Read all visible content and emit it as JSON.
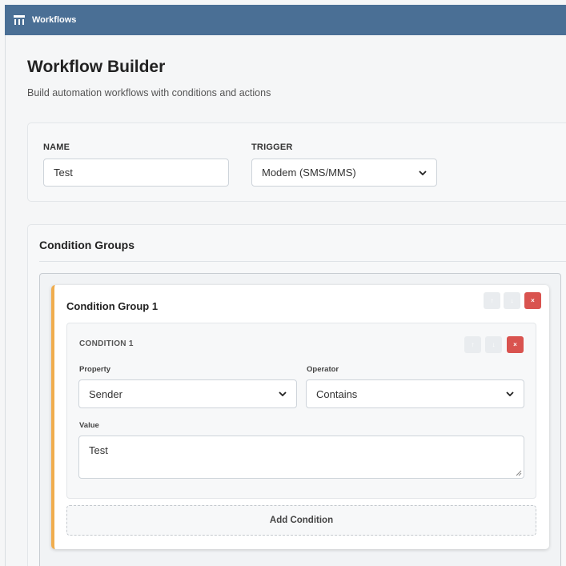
{
  "topbar": {
    "title": "Workflows",
    "icon": "sitemap-icon"
  },
  "page": {
    "title": "Workflow Builder",
    "subtitle": "Build automation workflows with conditions and actions"
  },
  "form": {
    "name_label": "NAME",
    "name_value": "Test",
    "trigger_label": "TRIGGER",
    "trigger_value": "Modem (SMS/MMS)"
  },
  "conditions": {
    "section_title": "Condition Groups",
    "groups": [
      {
        "title": "Condition Group 1",
        "accent_color": "#f0ad4e",
        "move_up_label": "↑",
        "move_down_label": "↓",
        "remove_label": "×",
        "conditions": [
          {
            "title": "CONDITION 1",
            "move_up_label": "↑",
            "move_down_label": "↓",
            "remove_label": "×",
            "property_label": "Property",
            "property_value": "Sender",
            "operator_label": "Operator",
            "operator_value": "Contains",
            "value_label": "Value",
            "value": "Test"
          }
        ],
        "add_condition_label": "Add Condition"
      }
    ]
  },
  "colors": {
    "topbar": "#4a6f95",
    "danger": "#d9534f",
    "group_accent": "#f0ad4e"
  }
}
